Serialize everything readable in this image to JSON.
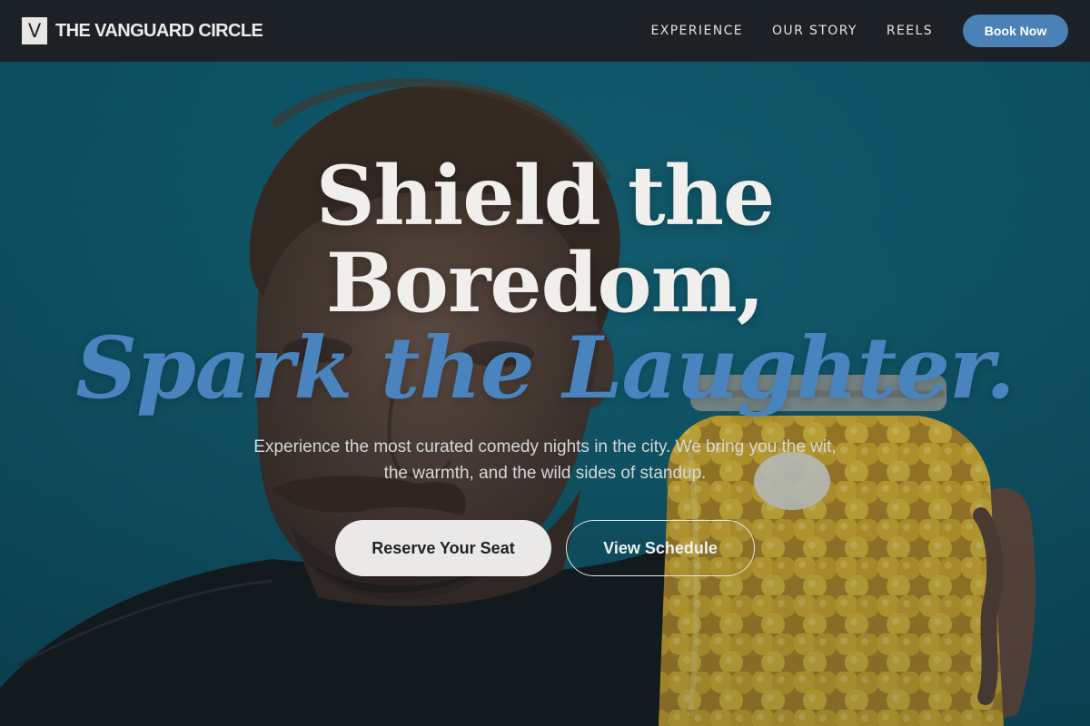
{
  "brand": {
    "mark": "V",
    "name": "THE VANGUARD CIRCLE"
  },
  "nav": {
    "links": [
      "EXPERIENCE",
      "OUR STORY",
      "REELS"
    ],
    "cta_label": "Book Now"
  },
  "hero": {
    "headline_line1": "Shield the",
    "headline_line2": "Boredom,",
    "headline_line3": "Spark the Laughter.",
    "subtitle": "Experience the most curated comedy nights in the city. We bring you the wit, the warmth, and the wild sides of standup.",
    "primary_button": "Reserve Your Seat",
    "secondary_button": "View Schedule"
  },
  "colors": {
    "nav_background": "#1c2125",
    "accent_blue": "#4a82b8",
    "hero_teal": "#0d5a6e",
    "headline_text": "#f1efec",
    "headline_accent": "#4a84bf"
  },
  "icons": {
    "logo": "v-monogram-icon"
  }
}
